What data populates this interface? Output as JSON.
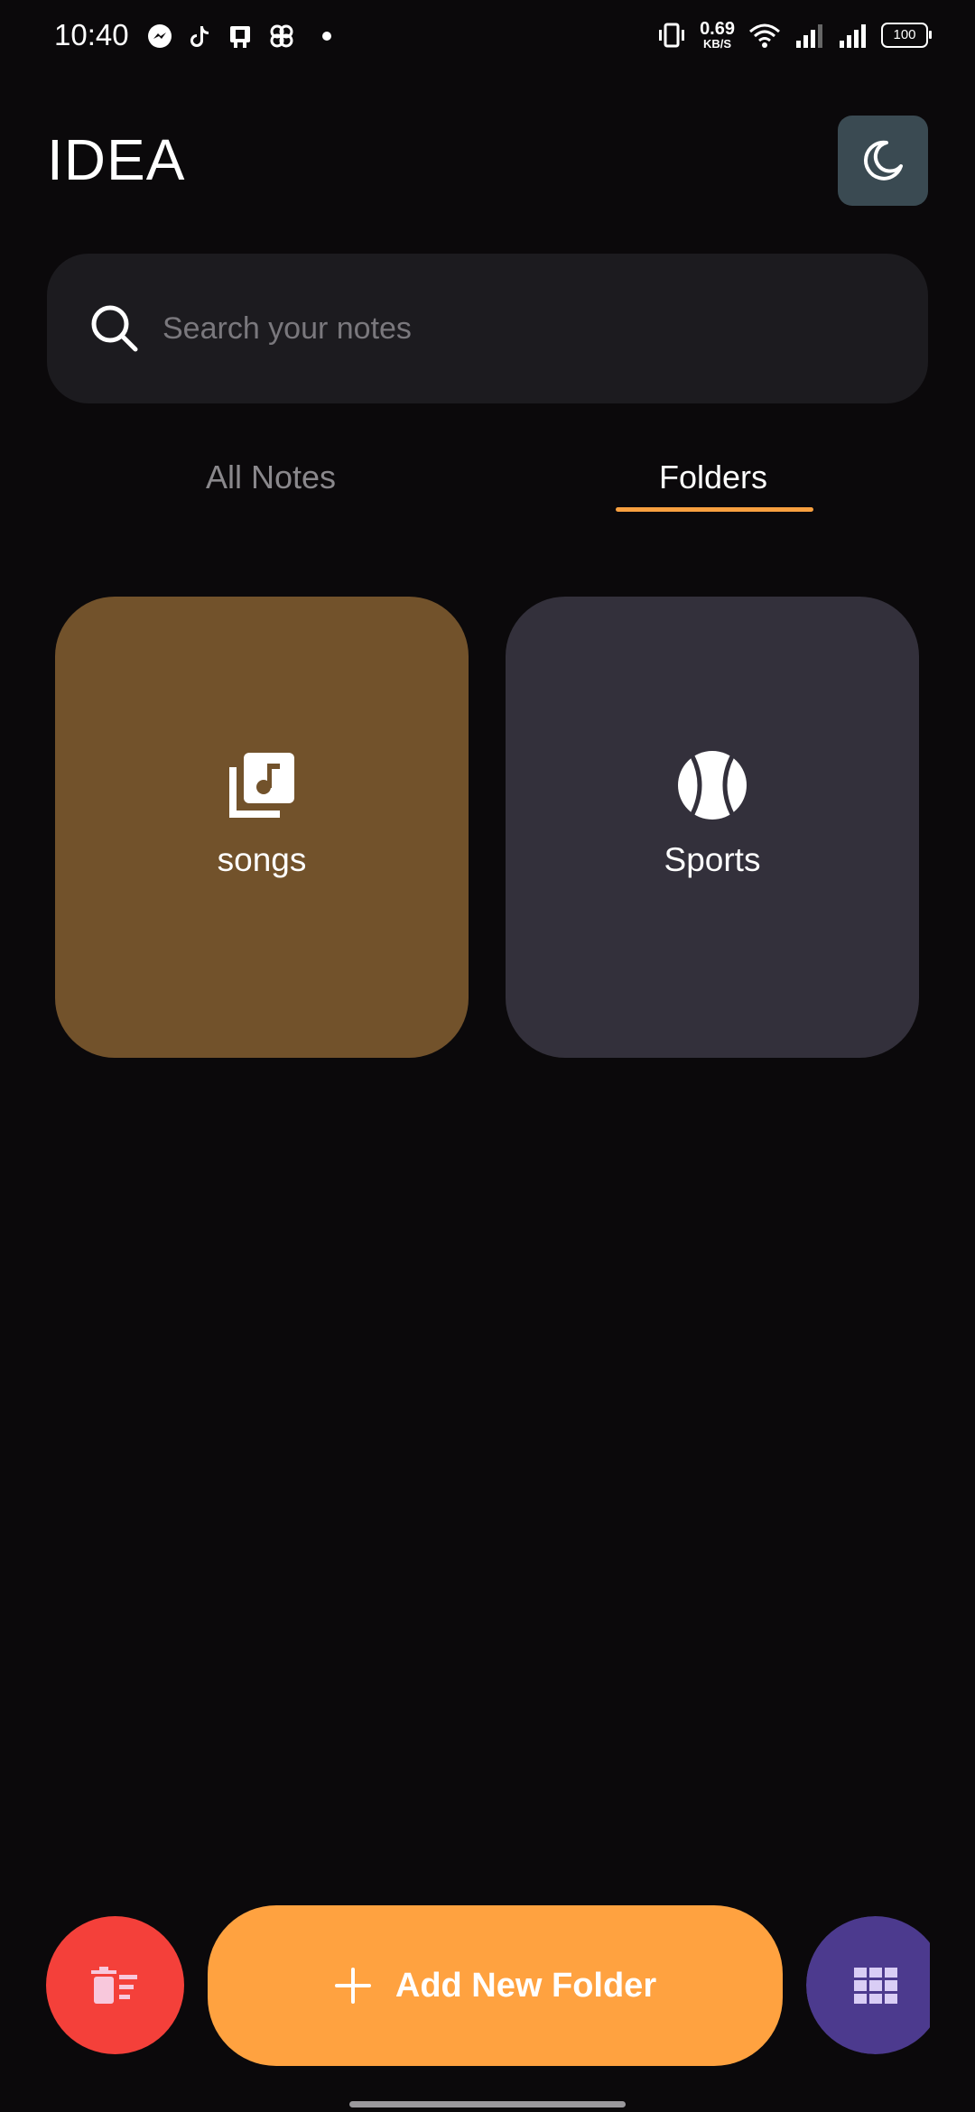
{
  "status_bar": {
    "time": "10:40",
    "net_speed_value": "0.69",
    "net_speed_unit": "KB/S",
    "battery": "100",
    "icons_left": [
      "messenger-icon",
      "tiktok-icon",
      "app-icon",
      "pinwheel-icon",
      "dot-icon"
    ],
    "icons_right": [
      "vibrate-icon",
      "wifi-icon",
      "signal-icon",
      "signal-icon"
    ]
  },
  "header": {
    "title": "IDEA",
    "theme_toggle_icon": "moon-icon"
  },
  "search": {
    "placeholder": "Search your notes",
    "value": ""
  },
  "tabs": [
    {
      "label": "All Notes",
      "active": false
    },
    {
      "label": "Folders",
      "active": true
    }
  ],
  "folders": [
    {
      "name": "songs",
      "icon": "music-library-icon",
      "color": "#72522b"
    },
    {
      "name": "Sports",
      "icon": "tennis-ball-icon",
      "color": "#33303b"
    }
  ],
  "actions": {
    "delete_icon": "delete-sweep-icon",
    "add_folder_label": "Add New Folder",
    "grid_icon": "grid-icon"
  },
  "colors": {
    "background": "#0b090b",
    "accent": "#ffa240",
    "delete": "#f4403a",
    "grid": "#4c3a8e",
    "theme_button": "#3a4a52"
  }
}
